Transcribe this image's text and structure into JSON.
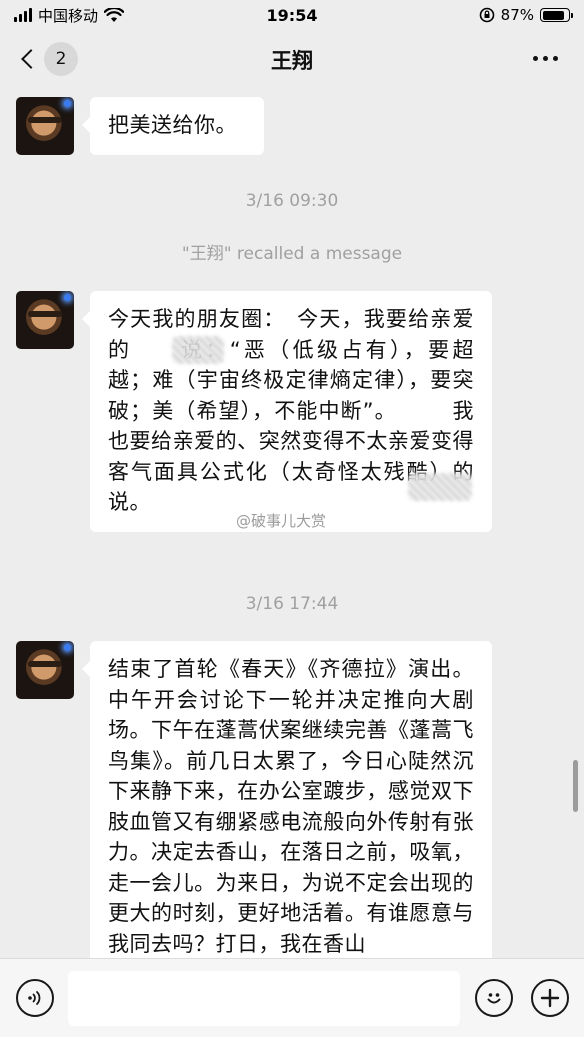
{
  "status_bar": {
    "carrier": "中国移动",
    "time": "19:54",
    "battery_percent": "87%",
    "battery_level": 0.87,
    "icons": [
      "signal-icon",
      "wifi-icon",
      "rotation-lock-icon",
      "battery-icon"
    ]
  },
  "nav": {
    "unread_count": "2",
    "title": "王翔",
    "more_label": "•••"
  },
  "messages": {
    "m1": "把美送给你。",
    "t1": "3/16 09:30",
    "recall": "\"王翔\" recalled a message",
    "m2": "今天我的朋友圈：　今天，我要给亲爱的　　说：“恶（低级占有），要超越；难（宇宙终极定律熵定律），要突破；美（希望），不能中断”。　　　我也要给亲爱的、突然变得不太亲爱变得客气面具公式化（太奇怪太残酷）的　　说。",
    "t2": "3/16 17:44",
    "m3": "结束了首轮《春天》《齐德拉》演出。中午开会讨论下一轮并决定推向大剧场。下午在蓬蒿伏案继续完善《蓬蒿飞鸟集》。前几日太累了，今日心陡然沉下来静下来，在办公室踱步，感觉双下肢血管又有绷紧感电流般向外传射有张力。决定去香山，在落日之前，吸氧，走一会儿。为来日，为说不定会出现的更大的时刻，更好地活着。有谁愿意与我同去吗？打日，我在香山"
  },
  "watermark": "@破事儿大赏",
  "input": {
    "placeholder": ""
  }
}
